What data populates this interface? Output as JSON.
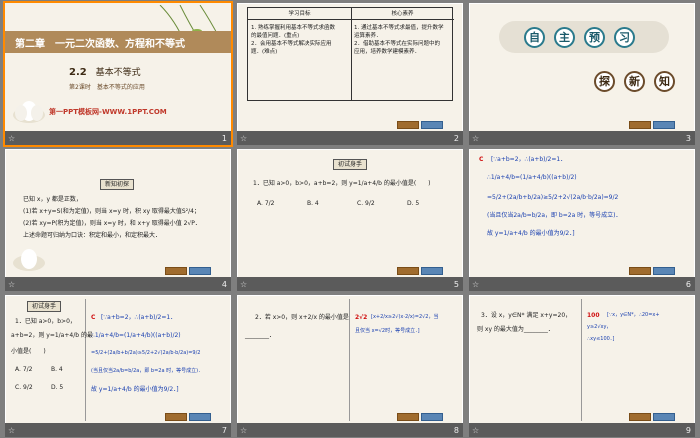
{
  "slides": [
    {
      "number": "1",
      "chapter": "第二章　一元二次函数、方程和不等式",
      "section_num": "2.2",
      "section_title": "基本不等式",
      "sub": "第2课时　基本不等式的应用",
      "brand": "第一PPT模板网-WWW.1PPT.COM"
    },
    {
      "number": "2",
      "col1_head": "学习目标",
      "col2_head": "核心素养",
      "col1_lines": [
        "1. 熟练掌握利用基本不等式求函数",
        "的最值问题．(重点)",
        "2．会用基本不等式解决实际应用",
        "题．(难点)"
      ],
      "col2_lines": [
        "1. 通过基本不等式求最值，提升数学",
        "运算素养．",
        "2．借助基本不等式在实际问题中的",
        "应用，培养数学建模素养．"
      ]
    },
    {
      "number": "3",
      "row1": [
        "自",
        "主",
        "预",
        "习"
      ],
      "row2": [
        "探",
        "新",
        "知"
      ]
    },
    {
      "number": "4",
      "tag": "新知初探",
      "lines": [
        "已知 x，y 都是正数，",
        "(1)若 x+y=S(和为定值)，则当 x=y 时，积 xy 取得最大值S²/4；",
        "(2)若 xy=P(积为定值)，则当 x=y 时，和 x+y 取得最小值 2√P．",
        "上述命题可归纳为口诀：积定和最小，和定积最大．"
      ]
    },
    {
      "number": "5",
      "tag": "初试身手",
      "question": "1．已知 a>0，b>0，a+b=2，则 y=1/a+4/b 的最小值是(　　)",
      "options": [
        "A. 7/2",
        "B. 4",
        "C. 9/2",
        "D. 5"
      ]
    },
    {
      "number": "6",
      "answer": "C",
      "lines": [
        "[∵a+b=2，∴(a+b)/2=1．",
        "∴1/a+4/b=(1/a+4/b)((a+b)/2)",
        "=5/2+(2a/b+b/2a)≥5/2+2√(2a/b·b/2a)=9/2",
        "(当且仅当2a/b=b/2a，即 b=2a 时，等号成立)．",
        "故 y=1/a+4/b 的最小值为9/2．]"
      ]
    },
    {
      "number": "7",
      "tag": "初试身手",
      "question_lines": [
        "1．已知 a>0，b>0，",
        "a+b=2，则 y=1/a+4/b 的最",
        "小值是(　　)"
      ],
      "options": [
        "A. 7/2",
        "B. 4",
        "C. 9/2",
        "D. 5"
      ],
      "answer": "C",
      "lines": [
        "[∵a+b=2，∴(a+b)/2=1．",
        "∴1/a+4/b=(1/a+4/b)((a+b)/2)",
        "=5/2+(2a/b+b/2a)≥5/2+2√(2a/b·b/2a)=9/2",
        "(当且仅当2a/b=b/2a，即 b=2a 时，等号成立)．",
        "故 y=1/a+4/b 的最小值为9/2．]"
      ]
    },
    {
      "number": "8",
      "question_lines": [
        "2．若 x>0，则 x+2/x 的最小值是",
        "________．"
      ],
      "answer": "2√2",
      "lines": [
        "[x+2/x≥2√(x·2/x)=2√2，当",
        "且仅当 x=√2时，等号成立．]"
      ]
    },
    {
      "number": "9",
      "question_lines": [
        "3．设 x，y∈N* 满足 x+y=20，",
        "则 xy 的最大值为________．"
      ],
      "answer": "100",
      "lines": [
        "[∵x，y∈N*，∴20=x+",
        "y≥2√xy，",
        "∴xy≤100．]"
      ]
    }
  ],
  "nav_labels": [
    "返回",
    "前页"
  ],
  "colors": {
    "accent_red": "#d01010",
    "banner": "#b08a5a",
    "selected_border": "#ff8a00"
  }
}
